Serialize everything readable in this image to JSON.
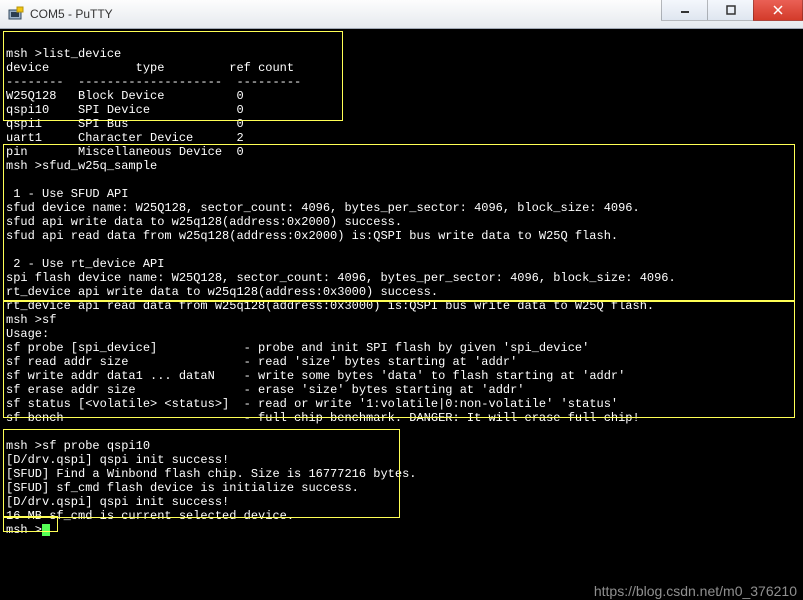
{
  "window": {
    "title": "COM5 - PuTTY"
  },
  "section1": {
    "prompt": "msh >list_device",
    "header_device": "device",
    "header_type": "type",
    "header_ref": "ref count",
    "sep": "--------  --------------------  ---------",
    "rows_boxed": [
      {
        "d": "W25Q128",
        "t": "Block Device",
        "r": "0"
      },
      {
        "d": "qspi10",
        "t": "SPI Device",
        "r": "0"
      },
      {
        "d": "qspi1",
        "t": "SPI Bus",
        "r": "0"
      }
    ],
    "rows_after": [
      {
        "d": "uart1",
        "t": "Character Device",
        "r": "2"
      },
      {
        "d": "pin",
        "t": "Miscellaneous Device",
        "r": "0"
      }
    ]
  },
  "section2": {
    "prompt": "msh >sfud_w25q_sample",
    "lines": [
      "",
      " 1 - Use SFUD API",
      "sfud device name: W25Q128, sector_count: 4096, bytes_per_sector: 4096, block_size: 4096.",
      "sfud api write data to w25q128(address:0x2000) success.",
      "sfud api read data from w25q128(address:0x2000) is:QSPI bus write data to W25Q flash.",
      "",
      " 2 - Use rt_device API",
      "spi flash device name: W25Q128, sector_count: 4096, bytes_per_sector: 4096, block_size: 4096.",
      "rt_device api write data to w25q128(address:0x3000) success.",
      "rt_device api read data from w25q128(address:0x3000) is:QSPI bus write data to W25Q flash."
    ]
  },
  "section3": {
    "prompt": "msh >sf",
    "usage": "Usage:",
    "rows": [
      {
        "cmd": "sf probe [spi_device]",
        "desc": "- probe and init SPI flash by given 'spi_device'"
      },
      {
        "cmd": "sf read addr size",
        "desc": "- read 'size' bytes starting at 'addr'"
      },
      {
        "cmd": "sf write addr data1 ... dataN",
        "desc": "- write some bytes 'data' to flash starting at 'addr'"
      },
      {
        "cmd": "sf erase addr size",
        "desc": "- erase 'size' bytes starting at 'addr'"
      },
      {
        "cmd": "sf status [<volatile> <status>]",
        "desc": "- read or write '1:volatile|0:non-volatile' 'status'"
      },
      {
        "cmd": "sf bench",
        "desc": "- full chip benchmark. DANGER: It will erase full chip!"
      }
    ]
  },
  "section4": {
    "prompt": "msh >sf probe qspi10",
    "lines": [
      "[D/drv.qspi] qspi init success!",
      "[SFUD] Find a Winbond flash chip. Size is 16777216 bytes.",
      "[SFUD] sf_cmd flash device is initialize success.",
      "[D/drv.qspi] qspi init success!",
      "16 MB sf_cmd is current selected device."
    ]
  },
  "final_prompt": "msh >",
  "watermark": "https://blog.csdn.net/m0_376210"
}
